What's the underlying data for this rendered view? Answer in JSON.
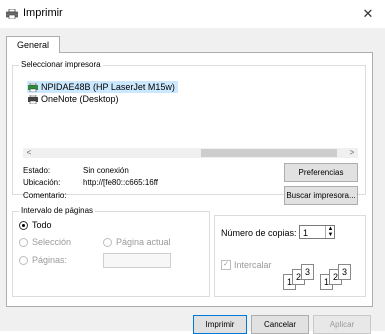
{
  "window": {
    "title": "Imprimir",
    "close_glyph": "✕"
  },
  "tabs": [
    {
      "label": "General"
    }
  ],
  "select_printer": {
    "legend": "Seleccionar impresora",
    "printers": [
      {
        "name": "NPIDAE48B (HP LaserJet M15w)",
        "selected": true,
        "icon": "network-printer-icon"
      },
      {
        "name": "OneNote (Desktop)",
        "selected": false,
        "icon": "printer-icon"
      }
    ],
    "scroll_left": "<",
    "scroll_right": ">"
  },
  "printer_info": {
    "status_label": "Estado:",
    "status_value": "Sin conexión",
    "location_label": "Ubicación:",
    "location_value": "http://[fe80::c665:16ff",
    "comment_label": "Comentario:",
    "preferences_button": "Preferencias",
    "find_printer_button": "Buscar impresora..."
  },
  "page_range": {
    "legend": "Intervalo de páginas",
    "all": "Todo",
    "selection": "Selección",
    "current_page": "Página actual",
    "pages": "Páginas:"
  },
  "copies": {
    "label": "Número de copias:",
    "value": "1",
    "collate_label": "Intercalar",
    "collate_checked": true,
    "page_numbers": [
      "1",
      "2",
      "3"
    ]
  },
  "footer": {
    "print_button": "Imprimir",
    "cancel_button": "Cancelar",
    "apply_button": "Aplicar"
  },
  "colors": {
    "selection": "#cce8ff",
    "accent": "#0078d7"
  }
}
